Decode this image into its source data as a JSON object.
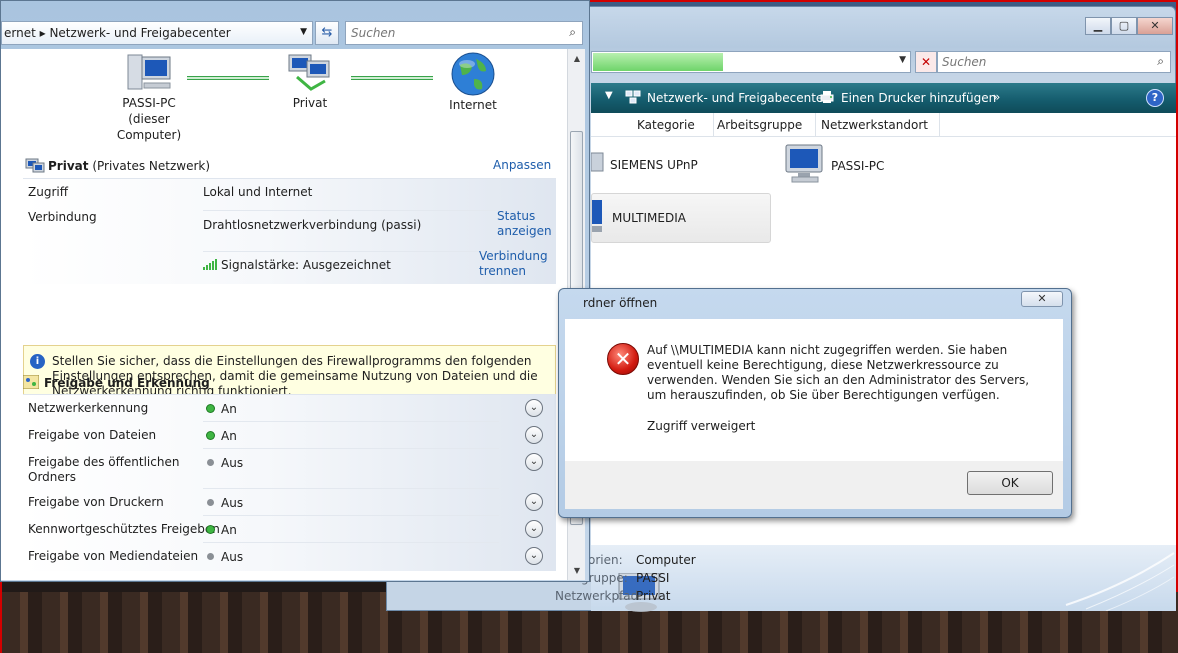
{
  "back_window": {
    "search_placeholder": "Suchen",
    "toolbar": {
      "network_center": "Netzwerk- und Freigabecenter",
      "add_printer": "Einen Drucker hinzufügen",
      "more": "»",
      "help": "?"
    },
    "columns": [
      "Kategorie",
      "Arbeitsgruppe",
      "Netzwerkstandort"
    ],
    "items": [
      {
        "label": "SIEMENS UPnP",
        "icon": "upnp-device-icon"
      },
      {
        "label": "PASSI-PC",
        "icon": "computer-icon"
      },
      {
        "label": "MULTIMEDIA",
        "icon": "computer-icon"
      }
    ],
    "details": [
      {
        "label": "egorien:",
        "value": "Computer"
      },
      {
        "label": "gruppe:",
        "value": "PASSI"
      },
      {
        "label": "Netzwerkpfad:",
        "value": "Privat"
      }
    ]
  },
  "front_window": {
    "address": "ernet  ▸  Netzwerk- und Freigabecenter",
    "search_placeholder": "Suchen",
    "map": [
      {
        "line1": "PASSI-PC",
        "line2": "(dieser Computer)"
      },
      {
        "line1": "Privat",
        "line2": ""
      },
      {
        "line1": "Internet",
        "line2": ""
      }
    ],
    "network": {
      "name": "Privat",
      "type": "(Privates Netzwerk)",
      "customize": "Anpassen",
      "rows": [
        {
          "label": "Zugriff",
          "value": "Lokal und Internet"
        },
        {
          "label": "Verbindung",
          "value": "Drahtlosnetzwerkverbindung (passi)",
          "action": "Status anzeigen"
        },
        {
          "label": "",
          "value": "Signalstärke: Ausgezeichnet",
          "action": "Verbindung trennen"
        }
      ]
    },
    "info": "Stellen Sie sicher, dass die Einstellungen des Firewallprogramms den folgenden Einstellungen entsprechen, damit die gemeinsame Nutzung von Dateien und die Netzwerkerkennung richtig funktioniert.",
    "sharing": {
      "title": "Freigabe und Erkennung",
      "rows": [
        {
          "label": "Netzwerkerkennung",
          "status": "An",
          "on": true
        },
        {
          "label": "Freigabe von Dateien",
          "status": "An",
          "on": true
        },
        {
          "label": "Freigabe des öffentlichen Ordners",
          "status": "Aus",
          "on": false
        },
        {
          "label": "Freigabe von Druckern",
          "status": "Aus",
          "on": false
        },
        {
          "label": "Kennwortgeschütztes Freigeben",
          "status": "An",
          "on": true
        },
        {
          "label": "Freigabe von Mediendateien",
          "status": "Aus",
          "on": false
        }
      ]
    }
  },
  "dialog": {
    "title": "rdner öffnen",
    "close": "✕",
    "message": "Auf \\\\MULTIMEDIA kann nicht zugegriffen werden. Sie haben eventuell keine Berechtigung, diese Netzwerkressource zu verwenden. Wenden Sie sich an den Administrator des Servers, um herauszufinden, ob Sie über Berechtigungen verfügen.",
    "detail": "Zugriff verweigert",
    "ok": "OK"
  },
  "colors": {
    "toolbar": "#145b6c",
    "link": "#1e5dab",
    "status_on": "#3fb543",
    "status_off": "#8a8f95",
    "error": "#d21a10",
    "frame": "#d40000"
  }
}
